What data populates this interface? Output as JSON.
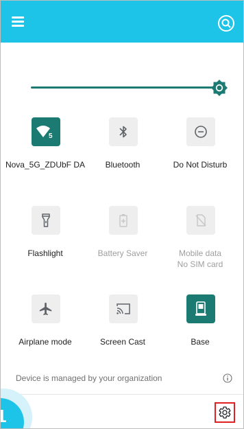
{
  "top_bar": {
    "menu_icon": "hamburger-menu-icon",
    "search_icon": "search-icon",
    "color": "#1ec4e8"
  },
  "brightness": {
    "level": 1.0,
    "thumb_icon": "brightness-icon"
  },
  "tiles": [
    {
      "label": "Nova_5G_ZDUbF DA",
      "icon": "wifi-icon",
      "badge": "5",
      "state": "on"
    },
    {
      "label": "Bluetooth",
      "icon": "bluetooth-icon",
      "state": "off"
    },
    {
      "label": "Do Not Disturb",
      "icon": "do-not-disturb-icon",
      "state": "off"
    },
    {
      "label": "Flashlight",
      "icon": "flashlight-icon",
      "state": "off"
    },
    {
      "label": "Battery Saver",
      "icon": "battery-saver-icon",
      "state": "unavailable"
    },
    {
      "label": "Mobile data\nNo SIM card",
      "icon": "mobile-data-icon",
      "state": "unavailable"
    },
    {
      "label": "Airplane mode",
      "icon": "airplane-icon",
      "state": "off"
    },
    {
      "label": "Screen Cast",
      "icon": "screen-cast-icon",
      "state": "off"
    },
    {
      "label": "Base",
      "icon": "base-icon",
      "state": "on"
    }
  ],
  "footer": {
    "managed_text": "Device is managed by your organization",
    "info_icon": "info-icon"
  },
  "step_badge": {
    "number": "1"
  },
  "settings": {
    "icon": "gear-icon",
    "highlight_color": "#e02020"
  },
  "colors": {
    "accent": "#1b7a72",
    "tile_off": "#eeeeee"
  }
}
